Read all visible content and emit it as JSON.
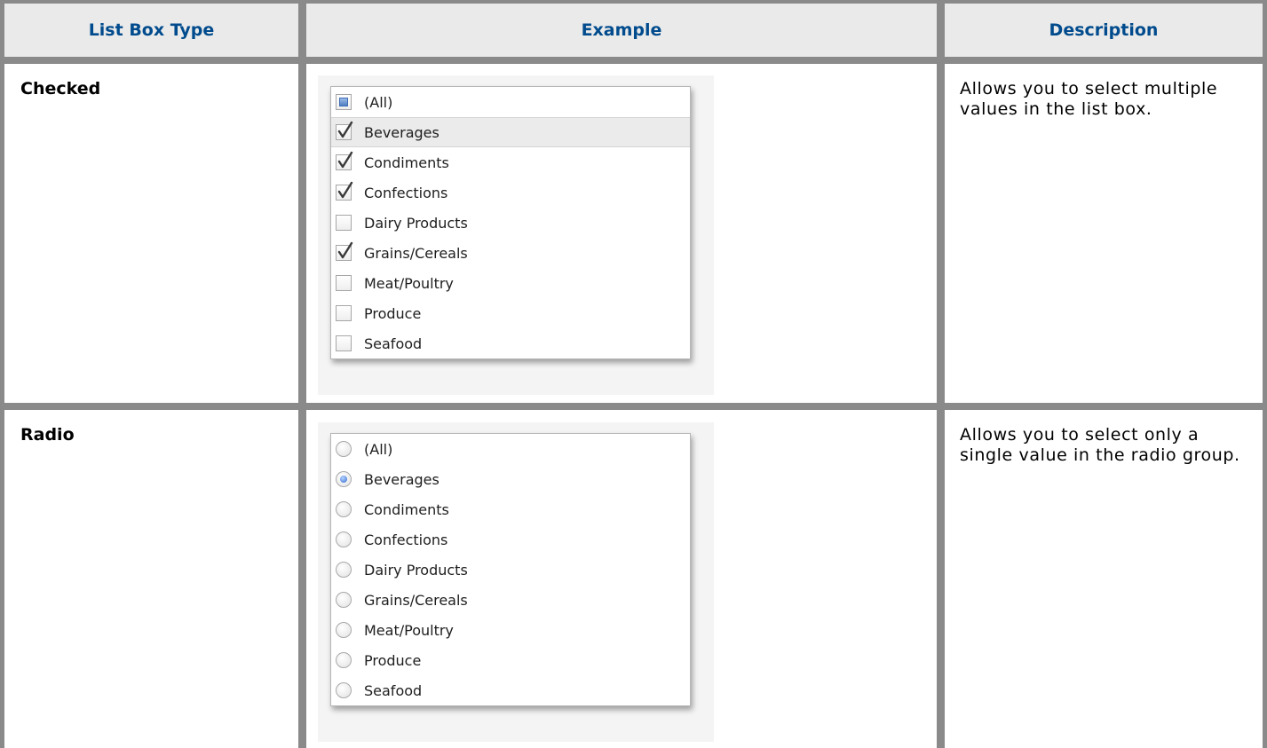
{
  "table": {
    "headers": {
      "type": "List Box Type",
      "example": "Example",
      "description": "Description"
    },
    "rows": [
      {
        "type": "Checked",
        "description": "Allows you to select multiple values in the list box.",
        "example": {
          "control": "checkbox",
          "items": [
            {
              "label": "(All)",
              "state": "indeterminate"
            },
            {
              "label": "Beverages",
              "state": "checked",
              "highlighted": true
            },
            {
              "label": "Condiments",
              "state": "checked"
            },
            {
              "label": "Confections",
              "state": "checked"
            },
            {
              "label": "Dairy Products",
              "state": "unchecked"
            },
            {
              "label": "Grains/Cereals",
              "state": "checked"
            },
            {
              "label": "Meat/Poultry",
              "state": "unchecked"
            },
            {
              "label": "Produce",
              "state": "unchecked"
            },
            {
              "label": "Seafood",
              "state": "unchecked"
            }
          ]
        }
      },
      {
        "type": "Radio",
        "description": "Allows you to select only a single value in the radio group.",
        "example": {
          "control": "radio",
          "items": [
            {
              "label": "(All)",
              "state": "unselected"
            },
            {
              "label": "Beverages",
              "state": "selected"
            },
            {
              "label": "Condiments",
              "state": "unselected"
            },
            {
              "label": "Confections",
              "state": "unselected"
            },
            {
              "label": "Dairy Products",
              "state": "unselected"
            },
            {
              "label": "Grains/Cereals",
              "state": "unselected"
            },
            {
              "label": "Meat/Poultry",
              "state": "unselected"
            },
            {
              "label": "Produce",
              "state": "unselected"
            },
            {
              "label": "Seafood",
              "state": "unselected"
            }
          ]
        }
      }
    ]
  },
  "colors": {
    "header_text": "#004b8d",
    "header_bg": "#eaeaea",
    "border": "#8a8a8a",
    "radio_selected": "#2f6ad0",
    "checkbox_indeterminate": "#4f7ec2"
  },
  "icons": {
    "checked": "checkmark-icon",
    "indeterminate": "indeterminate-square-icon",
    "unchecked": "empty-checkbox-icon",
    "radio_selected": "radio-selected-icon",
    "radio_unselected": "radio-unselected-icon"
  }
}
